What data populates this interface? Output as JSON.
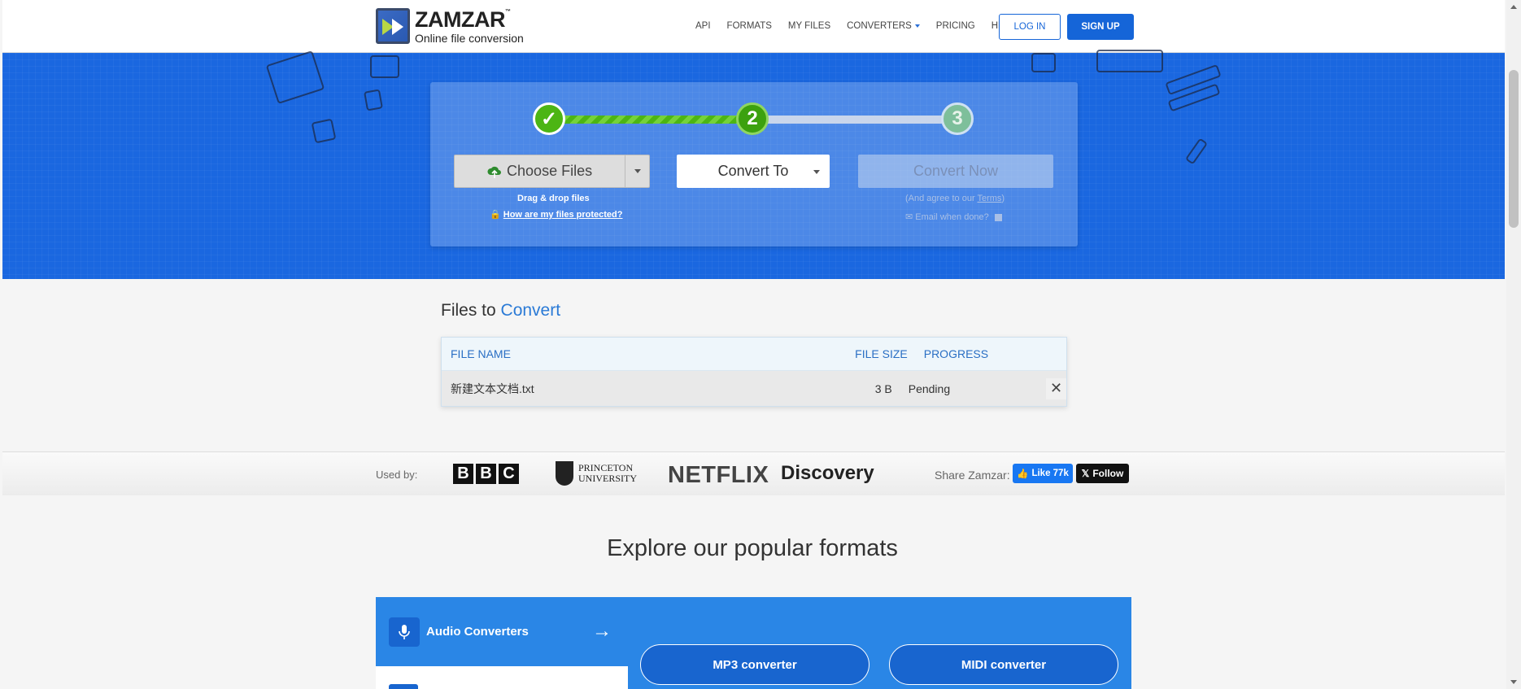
{
  "header": {
    "logo_name": "ZAMZAR",
    "logo_tm": "™",
    "logo_tagline": "Online file conversion",
    "nav": [
      {
        "label": "API"
      },
      {
        "label": "FORMATS"
      },
      {
        "label": "MY FILES"
      },
      {
        "label": "CONVERTERS"
      },
      {
        "label": "PRICING"
      },
      {
        "label": "HELP"
      }
    ],
    "login_label": "LOG IN",
    "signup_label": "SIGN UP"
  },
  "converter": {
    "steps": [
      {
        "label": "✓",
        "state": "done"
      },
      {
        "label": "2",
        "state": "active"
      },
      {
        "label": "3",
        "state": "pending"
      }
    ],
    "choose_files_label": "Choose Files",
    "drag_drop_text": "Drag & drop files",
    "protection_link": "How are my files protected?",
    "convert_to_label": "Convert To",
    "convert_now_label": "Convert Now",
    "agree_prefix": "(And agree to our ",
    "terms_link": "Terms",
    "agree_suffix": ")",
    "email_label": "Email when done?"
  },
  "files": {
    "title_prefix": "Files to ",
    "title_accent": "Convert",
    "columns": [
      "FILE NAME",
      "FILE SIZE",
      "PROGRESS"
    ],
    "rows": [
      {
        "name": "新建文本文档.txt",
        "size": "3 B",
        "progress": "Pending"
      }
    ]
  },
  "used_by": {
    "label": "Used by:",
    "logos": {
      "bbc": [
        "B",
        "B",
        "C"
      ],
      "princeton_line1": "PRINCETON",
      "princeton_line2": "UNIVERSITY",
      "netflix": "NETFLIX",
      "discovery": "Discovery"
    },
    "share_label": "Share Zamzar:",
    "like_label": "Like 77k",
    "follow_label": "Follow"
  },
  "explore": {
    "title": "Explore our popular formats",
    "category": "Audio Converters",
    "converters": [
      "MP3 converter",
      "MIDI converter"
    ]
  },
  "colors": {
    "brand_blue": "#1565d8",
    "hero_blue": "#1a67e0",
    "success_green": "#4cb514"
  }
}
